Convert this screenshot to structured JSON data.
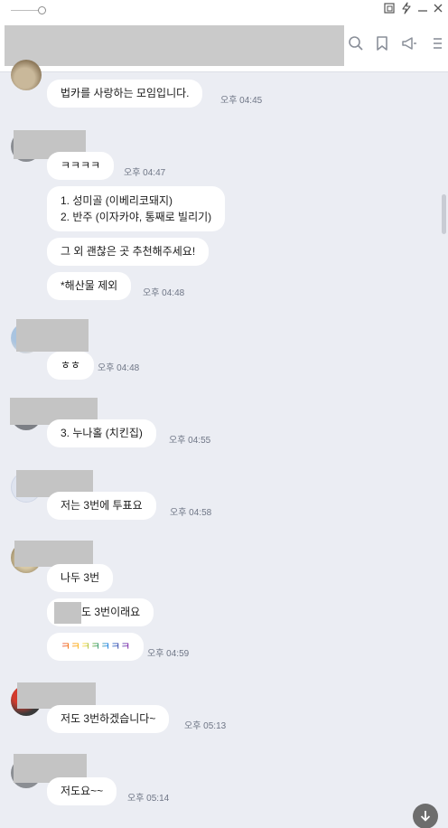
{
  "window": {
    "controls": [
      "slider",
      "pin-icon",
      "lightning-icon",
      "minimize-icon",
      "close-icon"
    ]
  },
  "toolbar": {
    "icons": [
      "search-icon",
      "bookmark-icon",
      "megaphone-icon",
      "menu-icon"
    ]
  },
  "messages": [
    {
      "text": "법카를 사랑하는 모임입니다.",
      "time": "오후 04:45"
    },
    {
      "text": "ㅋㅋㅋㅋ",
      "time": "오후 04:47"
    },
    {
      "lines": [
        "1. 성미골 (이베리코돼지)",
        "2. 반주 (이자카야, 통째로 빌리기)"
      ]
    },
    {
      "text": "그 외 괜찮은 곳 추천해주세요!"
    },
    {
      "text": "*해산물 제외",
      "time": "오후 04:48"
    },
    {
      "text": "ㅎㅎ",
      "time": "오후 04:48"
    },
    {
      "text": "3. 누나홀 (치킨집)",
      "time": "오후 04:55"
    },
    {
      "text": "저는 3번에 투표요",
      "time": "오후 04:58"
    },
    {
      "text": "나두 3번"
    },
    {
      "text": "도 3번이래요"
    },
    {
      "text": "ㅋㅋㅋㅋㅋㅋㅋ",
      "time": "오후 04:59"
    },
    {
      "text": "저도 3번하겠습니다~",
      "time": "오후 05:13"
    },
    {
      "text": "저도요~~",
      "time": "오후 05:14"
    }
  ],
  "colors": {
    "background": "#ebedf3",
    "bubble": "#ffffff",
    "time_text": "#6f7686",
    "redaction": "#c4c4c4",
    "rainbow": [
      "#e53935",
      "#fb8c00",
      "#fdd835",
      "#43a047",
      "#1e88e5",
      "#3949ab",
      "#8e24aa"
    ]
  }
}
